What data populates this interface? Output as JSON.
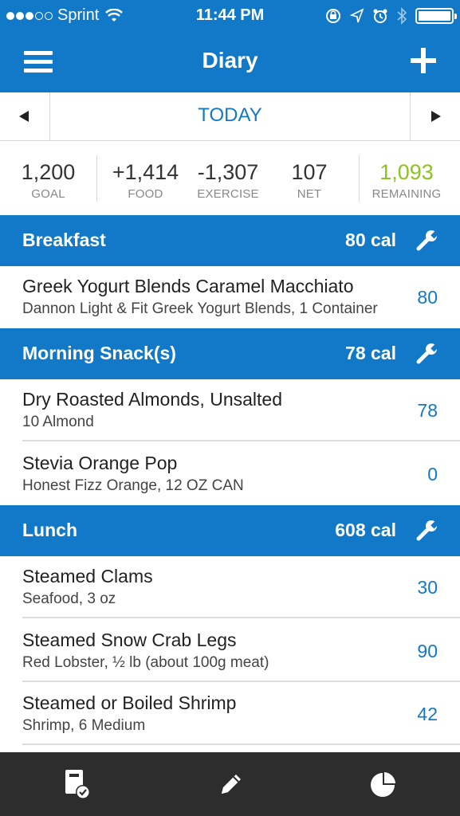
{
  "status_bar": {
    "carrier": "Sprint",
    "time": "11:44 PM",
    "signal_icon": "signal-dots-icon",
    "wifi_icon": "wifi-icon",
    "icons": [
      "rotation-lock-icon",
      "location-icon",
      "alarm-icon",
      "bluetooth-icon",
      "battery-icon"
    ]
  },
  "nav": {
    "title": "Diary",
    "menu_icon": "hamburger-menu-icon",
    "add_icon": "plus-icon"
  },
  "date_nav": {
    "label": "TODAY",
    "prev_icon": "triangle-left-icon",
    "next_icon": "triangle-right-icon"
  },
  "summary": {
    "goal": {
      "value": "1,200",
      "label": "GOAL"
    },
    "food": {
      "value": "+1,414",
      "label": "FOOD"
    },
    "exercise": {
      "value": "-1,307",
      "label": "EXERCISE"
    },
    "net": {
      "value": "107",
      "label": "NET"
    },
    "remaining": {
      "value": "1,093",
      "label": "REMAINING"
    }
  },
  "meals": [
    {
      "name": "Breakfast",
      "calories": "80 cal",
      "items": [
        {
          "food": "Greek Yogurt Blends Caramel Macchiato",
          "desc": "Dannon Light & Fit Greek Yogurt Blends, 1 Container",
          "kcal": "80"
        }
      ]
    },
    {
      "name": "Morning Snack(s)",
      "calories": "78 cal",
      "items": [
        {
          "food": "Dry Roasted Almonds, Unsalted",
          "desc": "10 Almond",
          "kcal": "78"
        },
        {
          "food": "Stevia Orange Pop",
          "desc": "Honest Fizz Orange, 12 OZ CAN",
          "kcal": "0"
        }
      ]
    },
    {
      "name": "Lunch",
      "calories": "608 cal",
      "items": [
        {
          "food": "Steamed Clams",
          "desc": "Seafood, 3 oz",
          "kcal": "30"
        },
        {
          "food": "Steamed Snow Crab Legs",
          "desc": "Red Lobster, ½ lb (about 100g meat)",
          "kcal": "90"
        },
        {
          "food": "Steamed or Boiled Shrimp",
          "desc": "Shrimp, 6 Medium",
          "kcal": "42"
        }
      ]
    }
  ],
  "tab_bar": {
    "tabs": [
      "diary-check-icon",
      "pencil-icon",
      "pie-chart-icon"
    ]
  },
  "colors": {
    "accent": "#1279c8",
    "remaining": "#8dc220",
    "tab_bar": "#2d2d2d"
  }
}
